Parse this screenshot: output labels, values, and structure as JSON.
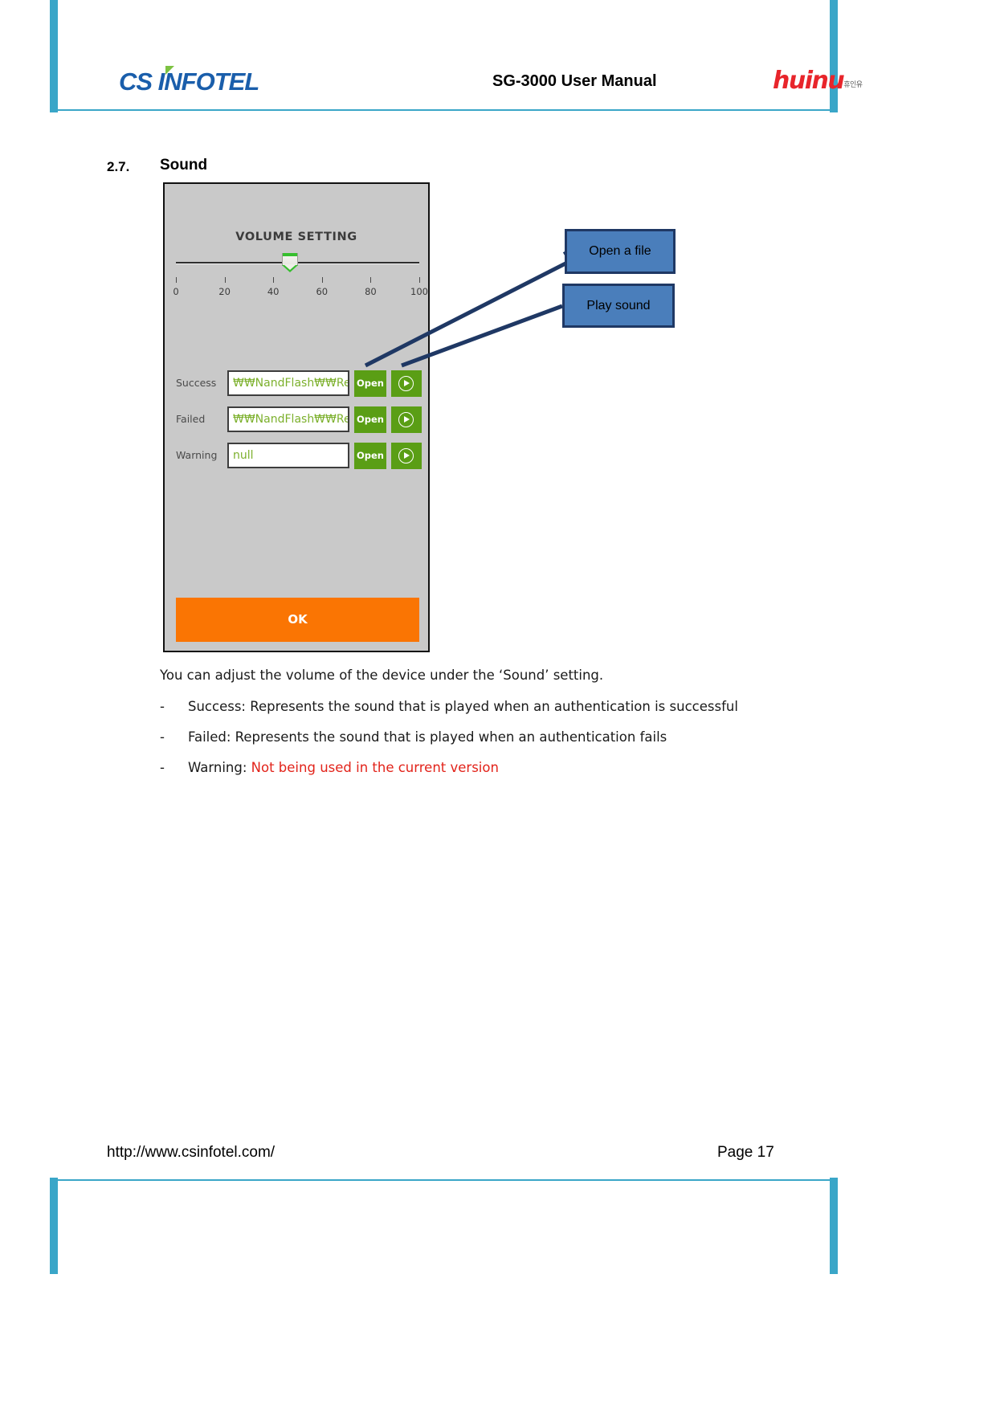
{
  "header": {
    "logo_primary": "CS INFOTEL",
    "logo_primary_cs": "CS",
    "logo_primary_infotel": "INFOTEL",
    "title": "SG-3000 User Manual",
    "logo_secondary": "huinu",
    "logo_secondary_sub": "휴인유"
  },
  "section": {
    "number": "2.7.",
    "title": "Sound"
  },
  "dialog": {
    "volume_title": "VOLUME SETTING",
    "slider": {
      "value": 47,
      "min": 0,
      "max": 100,
      "ticks": [
        0,
        20,
        40,
        60,
        80,
        100
      ],
      "tick_labels": [
        "0",
        "20",
        "40",
        "60",
        "80",
        "100"
      ]
    },
    "rows": [
      {
        "label": "Success",
        "value": "₩₩NandFlash₩₩Reso",
        "open_label": "Open",
        "play_icon": "play-circle-icon"
      },
      {
        "label": "Failed",
        "value": "₩₩NandFlash₩₩Reso",
        "open_label": "Open",
        "play_icon": "play-circle-icon"
      },
      {
        "label": "Warning",
        "value": "null",
        "open_label": "Open",
        "play_icon": "play-circle-icon"
      }
    ],
    "ok_label": "OK"
  },
  "callouts": [
    {
      "label": "Open a file"
    },
    {
      "label": "Play sound"
    }
  ],
  "body": {
    "intro": "You can adjust the volume of the device under the ‘Sound’ setting.",
    "dash": "-",
    "bullets": [
      {
        "text": "Success: Represents the sound that is played when an authentication is successful",
        "note": "",
        "note_color": ""
      },
      {
        "text": "Failed: Represents the sound that is played when an authentication fails",
        "note": "",
        "note_color": ""
      },
      {
        "text": "Warning: ",
        "note": "Not being used in the current version",
        "note_color": "#e2231a"
      }
    ]
  },
  "footer": {
    "url": "http://www.csinfotel.com/",
    "page": "Page 17"
  },
  "colors": {
    "accent_teal": "#3aa6c8",
    "brand_blue": "#1a5eab",
    "brand_red": "#e8252b",
    "button_green": "#5a9e15",
    "ok_orange": "#fa7503",
    "callout_blue": "#4a7ebb",
    "callout_border": "#1f3864",
    "warning_red": "#e2231a"
  }
}
